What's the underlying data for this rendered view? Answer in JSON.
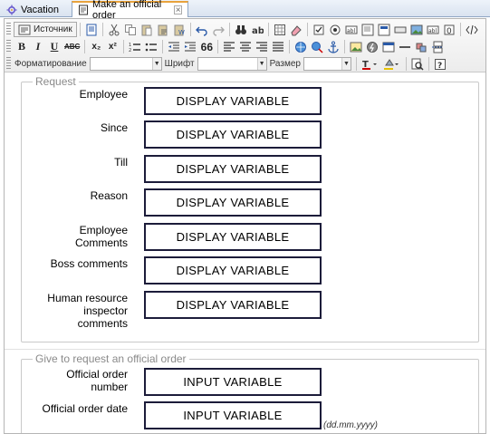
{
  "tabs": [
    {
      "label": "Vacation",
      "icon": "gear-icon",
      "active": false
    },
    {
      "label": "Make an official order",
      "icon": "document-icon",
      "active": true,
      "close": "×"
    }
  ],
  "toolbar": {
    "source_label": "Источник",
    "format_label": "Форматирование",
    "font_label": "Шрифт",
    "size_label": "Размер",
    "format_value": "",
    "font_value": "",
    "size_value": "",
    "bold": "B",
    "italic": "I",
    "underline": "U",
    "strike": "ABC",
    "subscript": "x₂",
    "superscript": "x²",
    "quote": "66"
  },
  "request": {
    "legend": "Request",
    "rows": [
      {
        "label": "Employee",
        "value": "DISPLAY VARIABLE"
      },
      {
        "label": "Since",
        "value": "DISPLAY VARIABLE"
      },
      {
        "label": "Till",
        "value": "DISPLAY VARIABLE"
      },
      {
        "label": "Reason",
        "value": "DISPLAY VARIABLE"
      },
      {
        "label": "Employee Comments",
        "value": "DISPLAY VARIABLE"
      },
      {
        "label": "Boss comments",
        "value": "DISPLAY VARIABLE"
      },
      {
        "label": "Human resource inspector comments",
        "value": "DISPLAY VARIABLE"
      }
    ]
  },
  "order": {
    "legend": "Give to request an official order",
    "rows": [
      {
        "label": "Official order number",
        "value": "INPUT VARIABLE"
      },
      {
        "label": "Official order date",
        "value": "INPUT VARIABLE",
        "hint": "(dd.mm.yyyy)"
      }
    ]
  }
}
